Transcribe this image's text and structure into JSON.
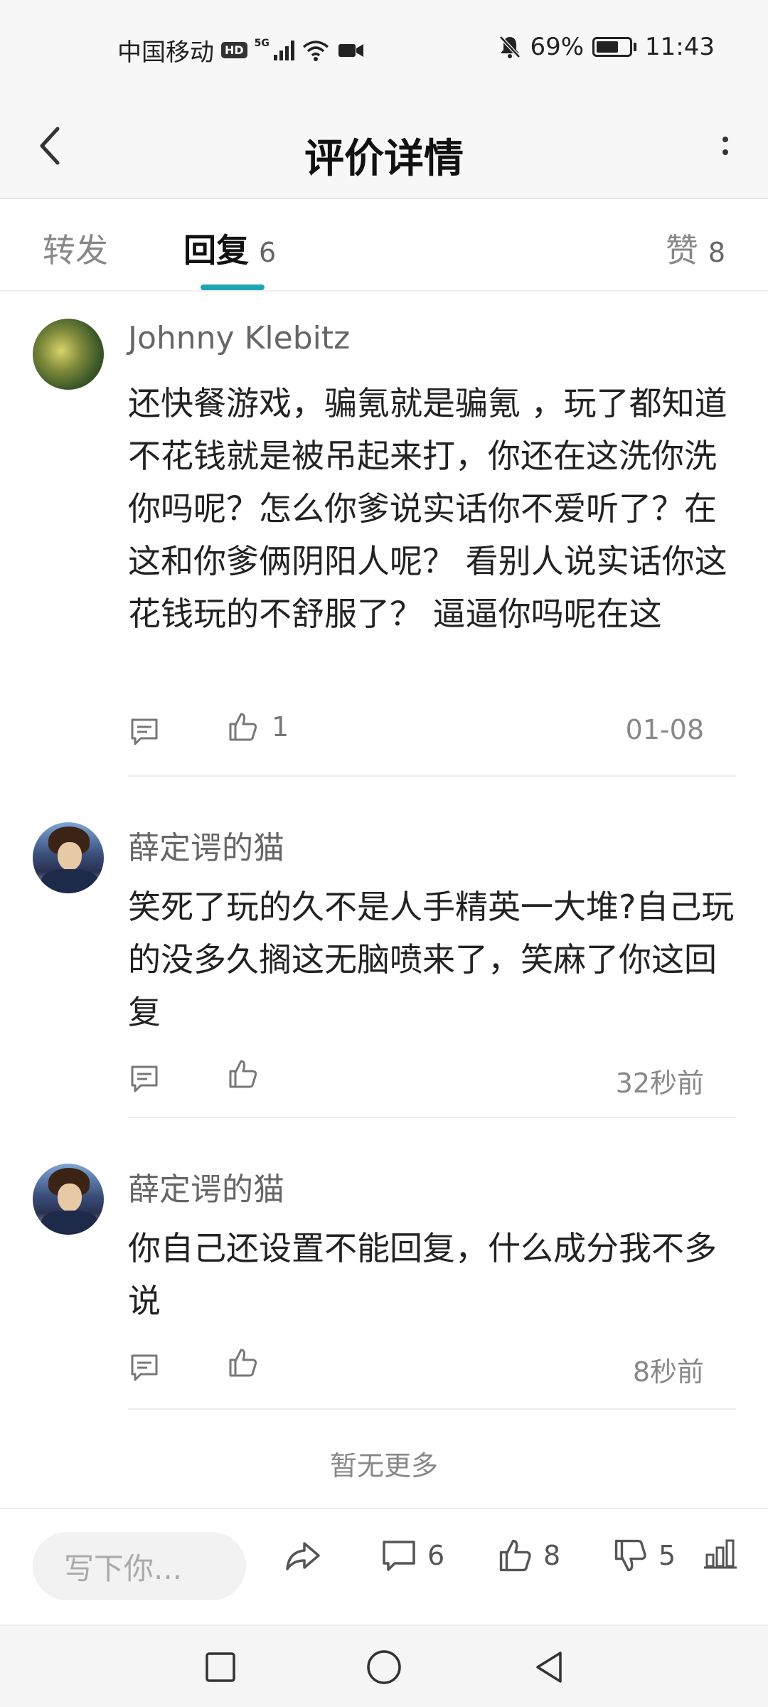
{
  "status_bar": {
    "carrier": "中国移动",
    "hd": "HD",
    "network": "5G",
    "battery": "69%",
    "battery_level": 0.69,
    "time": "11:43"
  },
  "header": {
    "title": "评价详情"
  },
  "tabs": [
    {
      "label": "转发",
      "count": ""
    },
    {
      "label": "回复",
      "count": "6"
    },
    {
      "label": "赞",
      "count": "8"
    }
  ],
  "active_tab": "回复",
  "accent_color": "#1fa6b3",
  "comments": [
    {
      "user": "Johnny Klebitz",
      "text": "还快餐游戏，骗氪就是骗氪 ，玩了都知道不花钱就是被吊起来打，你还在这洗你洗你吗呢？怎么你爹说实话你不爱听了？在这和你爹俩阴阳人呢？ 看别人说实话你这花钱玩的不舒服了？ 逼逼你吗呢在这",
      "likes": "1",
      "time": "01-08"
    },
    {
      "user": "薛定谔的猫",
      "text": "笑死了玩的久不是人手精英一大堆?自己玩的没多久搁这无脑喷来了，笑麻了你这回复",
      "likes": "",
      "time": "32秒前"
    },
    {
      "user": "薛定谔的猫",
      "text": "你自己还设置不能回复，什么成分我不多说",
      "likes": "",
      "time": "8秒前"
    }
  ],
  "no_more_text": "暂无更多",
  "bottom_bar": {
    "input_placeholder": "写下你...",
    "comment_count": "6",
    "like_count": "8",
    "dislike_count": "5"
  }
}
